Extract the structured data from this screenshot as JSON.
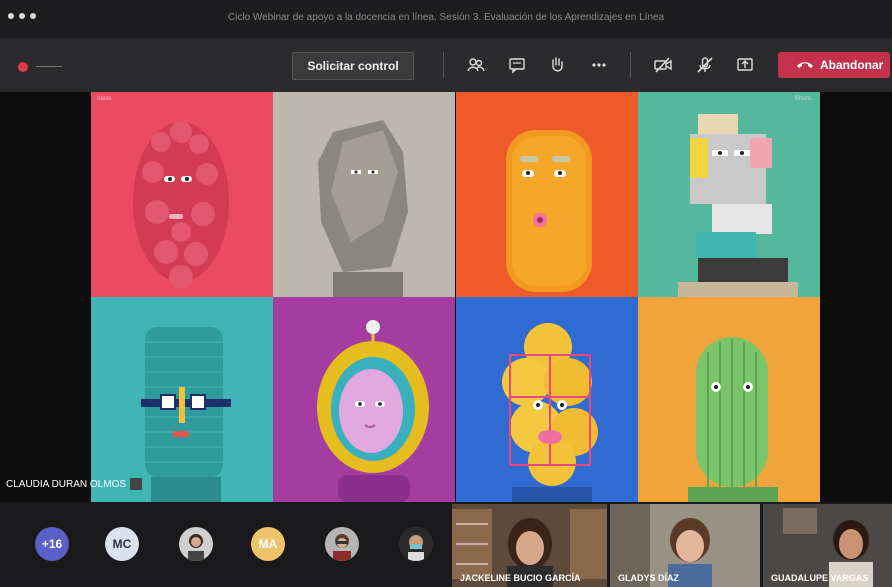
{
  "window": {
    "title": "Ciclo Webinar de apoyo a la docencia en línea. Sesión 3. Evaluación de los Aprendizajes en Línea"
  },
  "toolbar": {
    "request_control_label": "Solicitar control",
    "leave_label": "Abandonar",
    "colors": {
      "leave": "#c4314b",
      "recording": "#e03b4b"
    },
    "icons": [
      "participants-icon",
      "chat-icon",
      "raise-hand-icon",
      "more-options-icon",
      "camera-off-icon",
      "mic-off-icon",
      "share-screen-icon",
      "phone-hangup-icon"
    ]
  },
  "slide": {
    "corner_label_left": "Ideas",
    "corner_label_right": "Shorts",
    "tiles": [
      {
        "name": "pink-pom-pom-face",
        "bg": "#ea4a62"
      },
      {
        "name": "grey-rock-face",
        "bg": "#bdb8ad"
      },
      {
        "name": "orange-fuzzy-face",
        "bg": "#ee5a2a"
      },
      {
        "name": "cubist-face",
        "bg": "#55b79b"
      },
      {
        "name": "teal-cylinder-face",
        "bg": "#3fb5b5"
      },
      {
        "name": "astronaut-face",
        "bg": "#a53ca0"
      },
      {
        "name": "balloon-face",
        "bg": "#2f6bd0"
      },
      {
        "name": "green-cactus-face",
        "bg": "#f2a43c"
      }
    ]
  },
  "presenter_name": "CLAUDIA DURAN OLMOS",
  "participants": {
    "overflow_count": "+16",
    "initials": [
      "MC",
      "MA"
    ],
    "video_names": [
      "JACKELINE BUCIO GARCÍA",
      "GLADYS DÍAZ",
      "GUADALUPE VARGAS"
    ]
  }
}
